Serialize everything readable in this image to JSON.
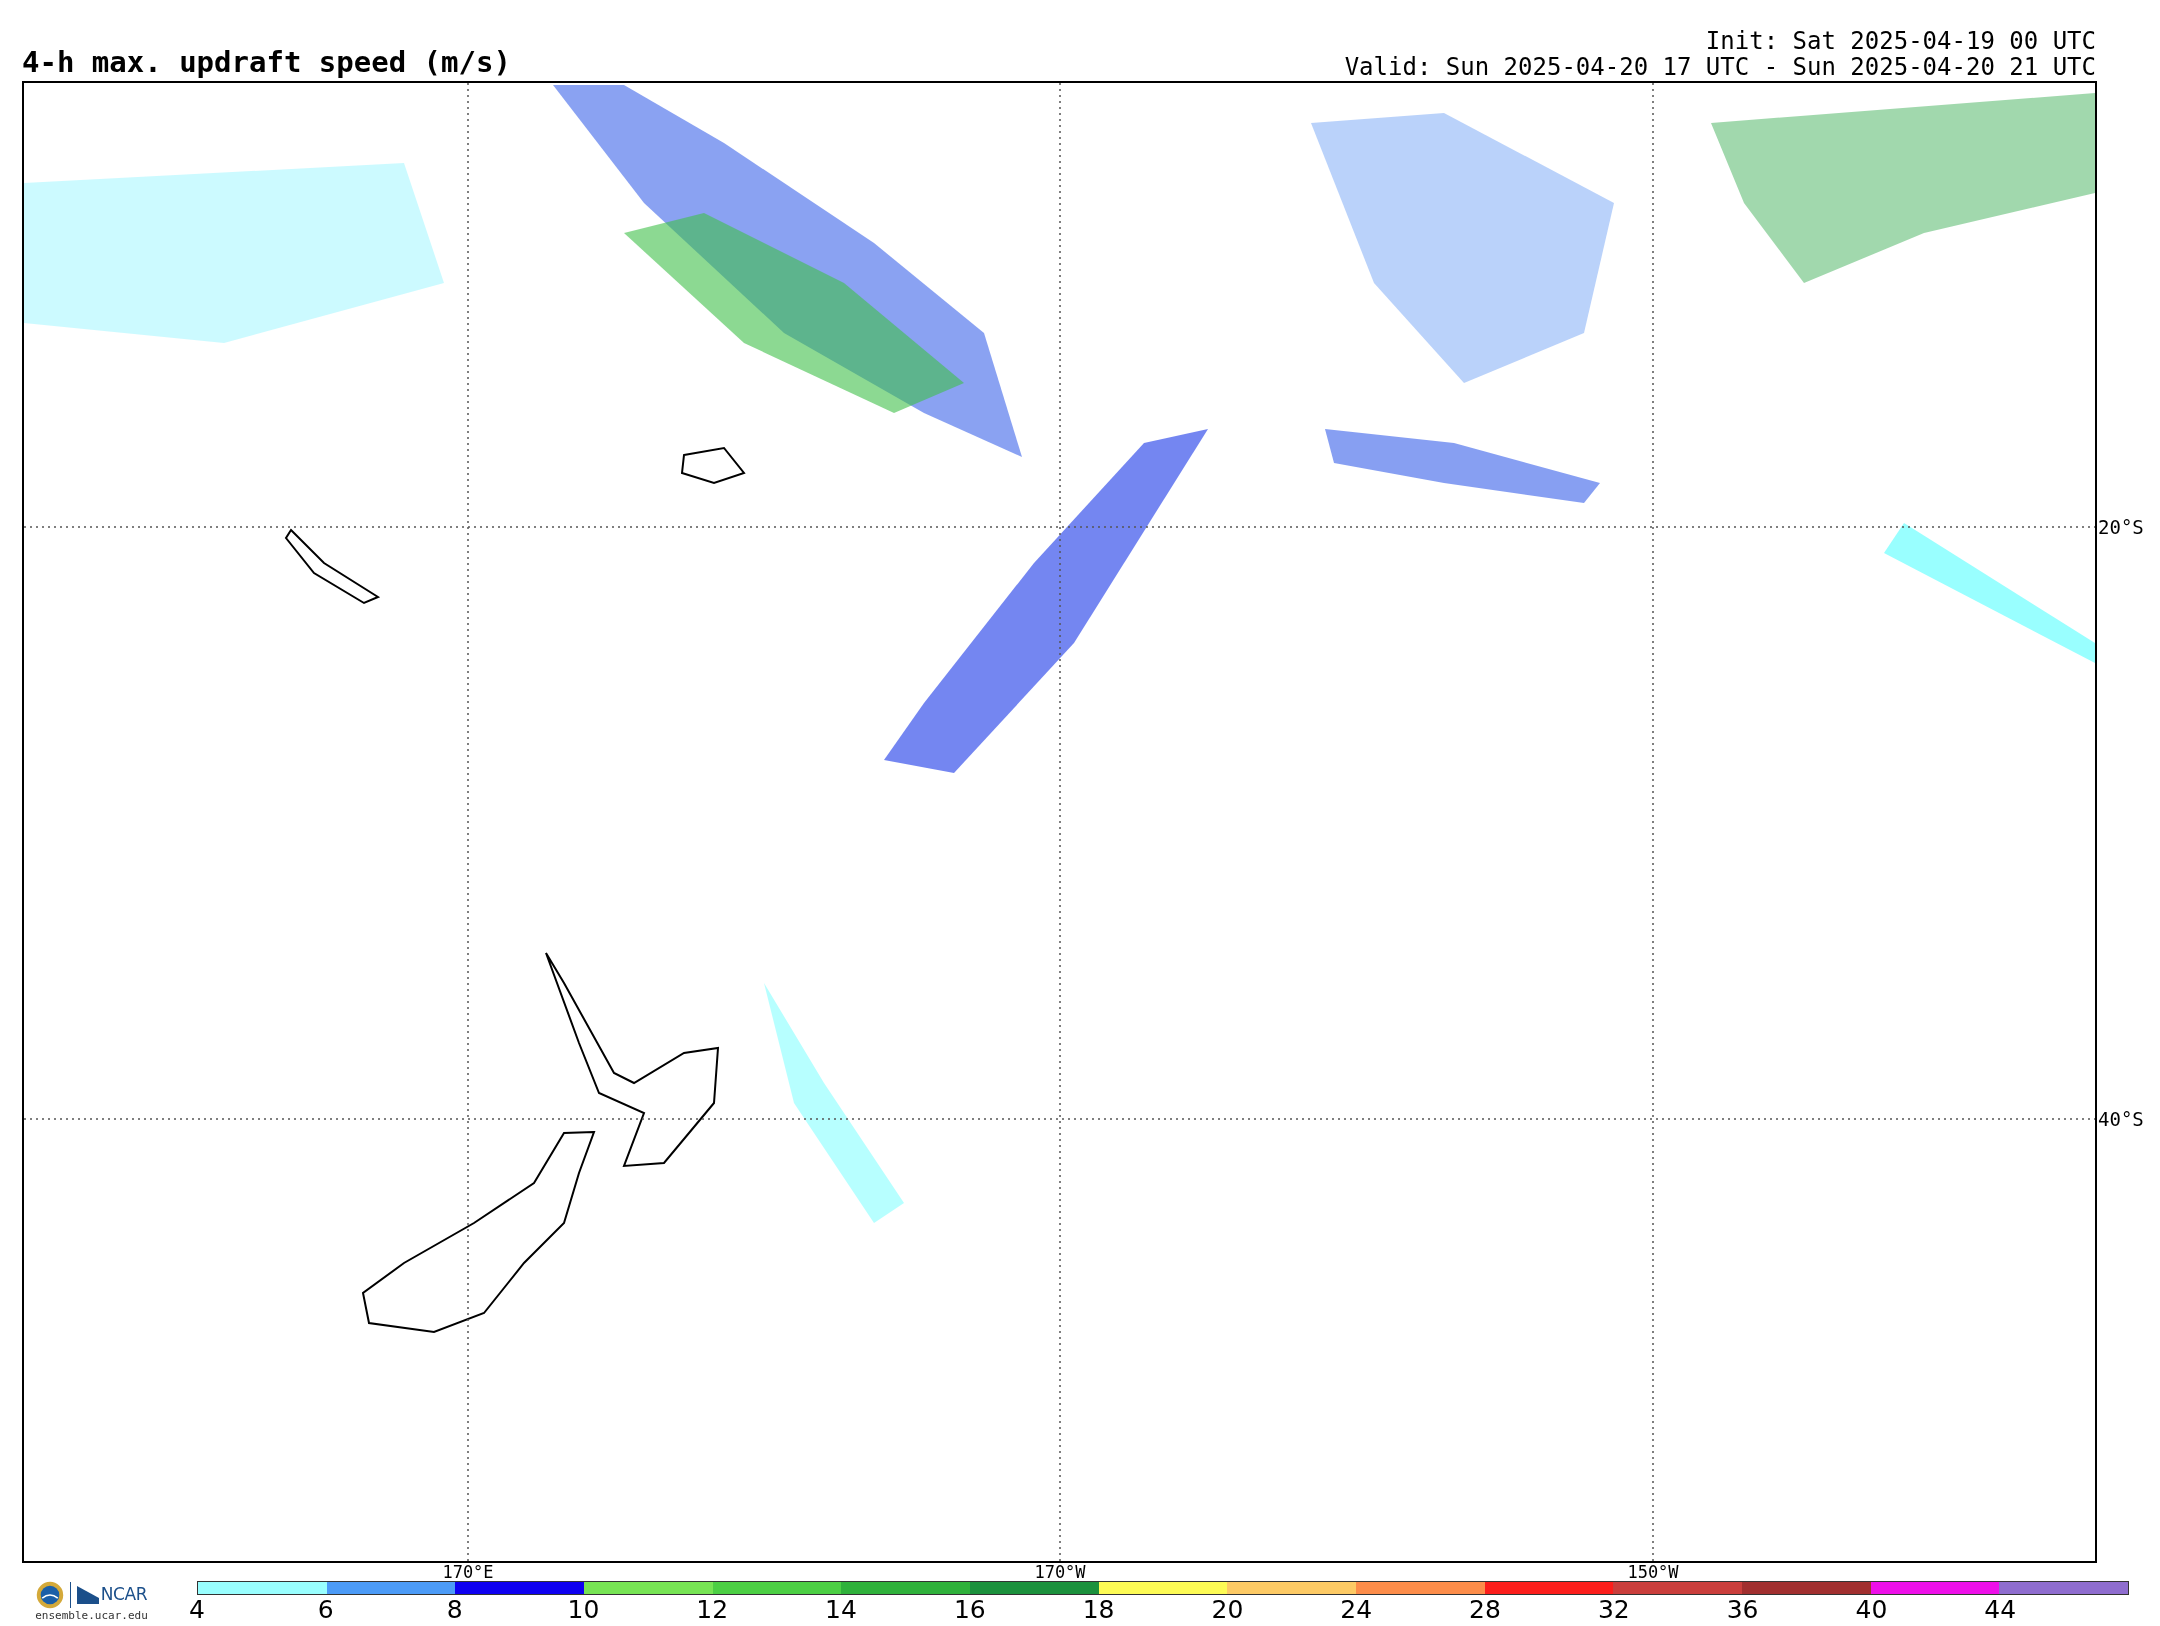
{
  "title": "4-h max. updraft speed (m/s)",
  "init": "Init: Sat 2025-04-19 00 UTC",
  "valid": "Valid: Sun 2025-04-20 17 UTC - Sun 2025-04-20 21 UTC",
  "map": {
    "lon_labels": [
      "170°E",
      "170°W",
      "150°W"
    ],
    "lat_labels": [
      "20°S",
      "40°S"
    ]
  },
  "branding": {
    "logo_text": "NCAR",
    "website": "ensemble.ucar.edu"
  },
  "colorbar": [
    {
      "label": "4",
      "color": "#99ffff"
    },
    {
      "label": "6",
      "color": "#4c9bf7"
    },
    {
      "label": "8",
      "color": "#0e00f0"
    },
    {
      "label": "10",
      "color": "#77e454"
    },
    {
      "label": "12",
      "color": "#4ccf44"
    },
    {
      "label": "14",
      "color": "#2fb13b"
    },
    {
      "label": "16",
      "color": "#1c913d"
    },
    {
      "label": "18",
      "color": "#fdfb55"
    },
    {
      "label": "20",
      "color": "#fdca65"
    },
    {
      "label": "24",
      "color": "#fd8d4a"
    },
    {
      "label": "28",
      "color": "#fc1e1b"
    },
    {
      "label": "32",
      "color": "#ca3e3c"
    },
    {
      "label": "36",
      "color": "#a12f2f"
    },
    {
      "label": "40",
      "color": "#ee0fe9"
    },
    {
      "label": "44",
      "color": "#8f6dcf"
    }
  ]
}
